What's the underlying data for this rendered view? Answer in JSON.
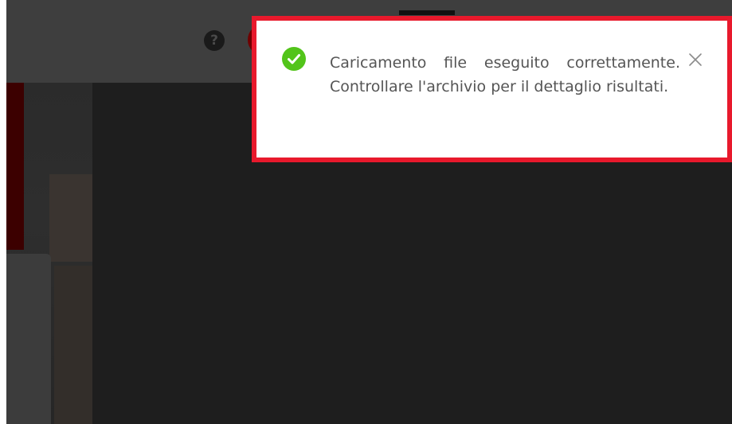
{
  "notification": {
    "message": "Caricamento file eseguito correttamente. Controllare l'archivio per il dettaglio risultati.",
    "type": "success",
    "icon": "check-circle-icon",
    "close_icon": "close-icon",
    "frame_color": "#e8192c",
    "success_color": "#52c41a"
  },
  "header": {
    "help_label": "?",
    "help_icon": "help-icon",
    "avatar_icon": "avatar",
    "avatar_color": "#700000"
  }
}
